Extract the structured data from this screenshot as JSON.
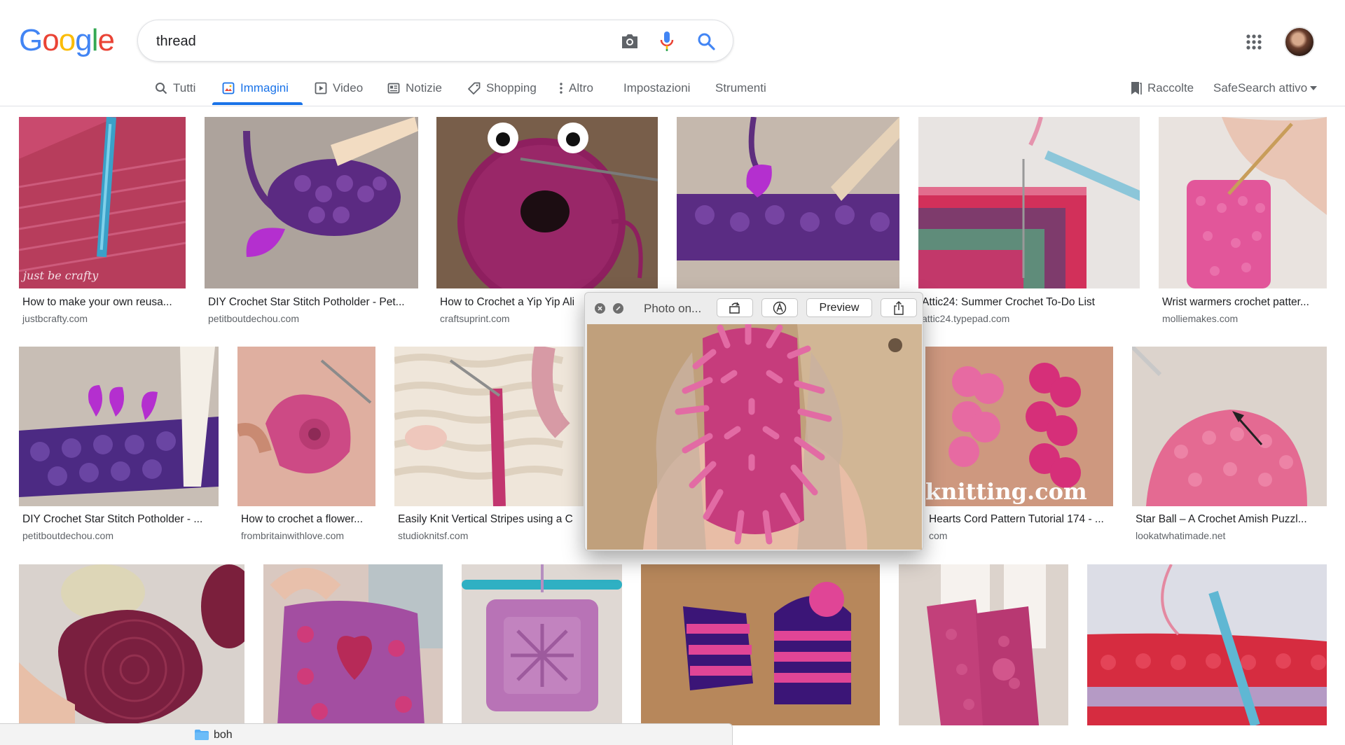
{
  "header": {
    "search_query": "thread",
    "tabs": [
      {
        "label": "Tutti",
        "icon": "search-icon"
      },
      {
        "label": "Immagini",
        "icon": "image-icon"
      },
      {
        "label": "Video",
        "icon": "video-icon"
      },
      {
        "label": "Notizie",
        "icon": "news-icon"
      },
      {
        "label": "Shopping",
        "icon": "tag-icon"
      },
      {
        "label": "Altro",
        "icon": "more-vert-icon"
      },
      {
        "label": "Impostazioni"
      },
      {
        "label": "Strumenti"
      }
    ],
    "collections_label": "Raccolte",
    "safesearch_label": "SafeSearch attivo",
    "colors": {
      "accent": "#1a73e8",
      "text": "#202124",
      "muted": "#5f6368"
    }
  },
  "results": [
    {
      "title": "How to make your own reusa...",
      "site": "justbcrafty.com"
    },
    {
      "title": "DIY Crochet Star Stitch Potholder - Pet...",
      "site": "petitboutdechou.com"
    },
    {
      "title": "How to Crochet a Yip Yip Ali",
      "site": "craftsuprint.com"
    },
    {
      "title": "",
      "site": ""
    },
    {
      "title": "Attic24: Summer Crochet To-Do List",
      "site": "attic24.typepad.com"
    },
    {
      "title": "Wrist warmers crochet patter...",
      "site": "molliemakes.com"
    },
    {
      "title": "DIY Crochet Star Stitch Potholder - ...",
      "site": "petitboutdechou.com"
    },
    {
      "title": "How to crochet a flower...",
      "site": "frombritainwithlove.com"
    },
    {
      "title": "Easily Knit Vertical Stripes using a C",
      "site": "studioknitsf.com"
    },
    {
      "title": "Hearts Cord Pattern Tutorial 174 - ...",
      "site": "com"
    },
    {
      "title": "Star Ball – A Crochet Amish Puzzl...",
      "site": "lookatwhatimade.net"
    },
    {
      "title": "",
      "site": ""
    },
    {
      "title": "",
      "site": ""
    },
    {
      "title": "",
      "site": ""
    },
    {
      "title": "",
      "site": ""
    },
    {
      "title": "",
      "site": ""
    },
    {
      "title": "",
      "site": ""
    }
  ],
  "image_watermarks": {
    "justbcrafty": "just be crafty",
    "knitting": "knitting.com"
  },
  "popup": {
    "title": "Photo on...",
    "preview_label": "Preview"
  },
  "finder": {
    "folder_label": "boh"
  }
}
